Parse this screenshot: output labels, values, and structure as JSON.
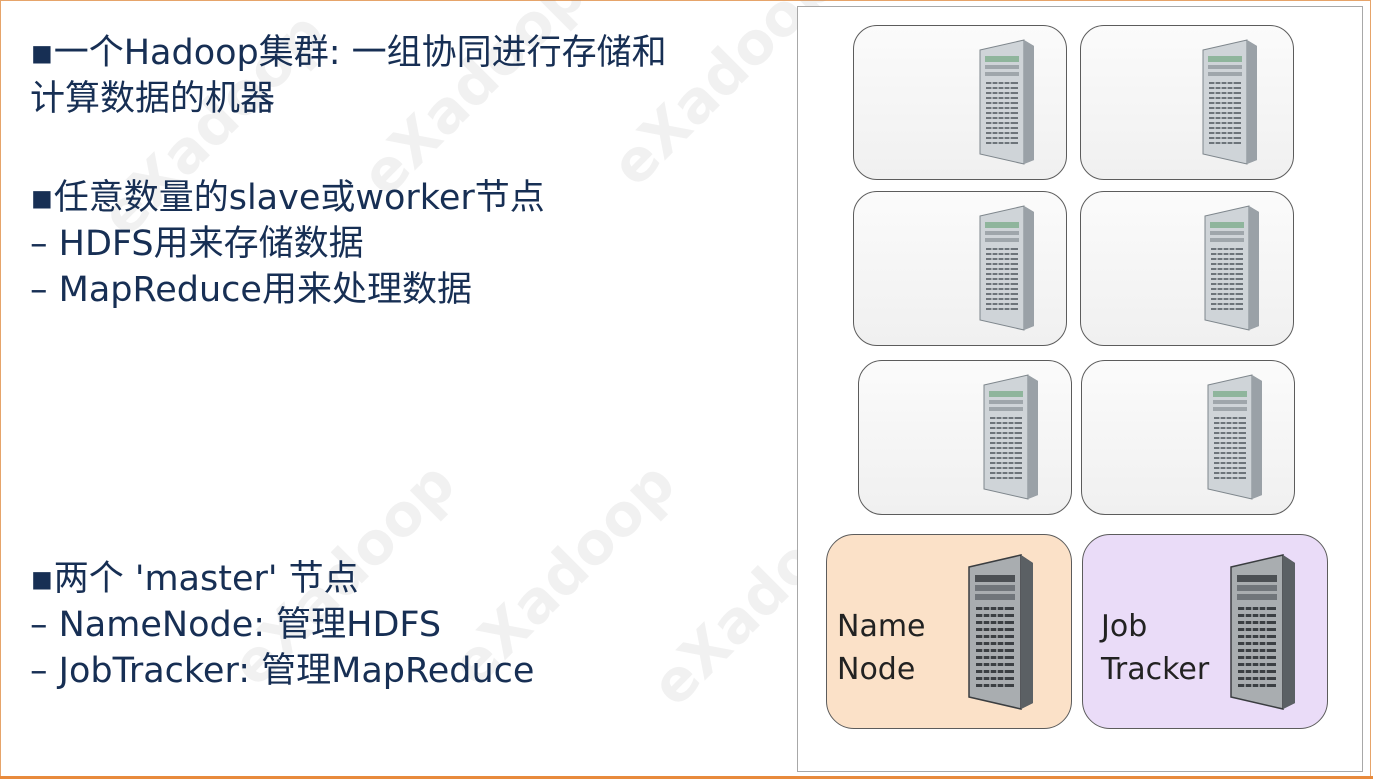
{
  "slide": {
    "section1": {
      "line1": "▪一个Hadoop集群: 一组协同进行存储和",
      "line2": "计算数据的机器"
    },
    "section2": {
      "line1": "▪任意数量的slave或worker节点",
      "line2": "– HDFS用来存储数据",
      "line3": "– MapReduce用来处理数据"
    },
    "section3": {
      "line1": "▪两个 'master' 节点",
      "line2": "– NameNode: 管理HDFS",
      "line3": "– JobTracker: 管理MapReduce"
    },
    "watermark": "eXadoop"
  },
  "diagram": {
    "worker_icon": "server-tower-icon",
    "name_node": {
      "line1": "Name",
      "line2": "Node"
    },
    "job_tracker": {
      "line1": "Job",
      "line2": "Tracker"
    }
  },
  "colors": {
    "text": "#172f54",
    "accent_line": "#e88a3c",
    "name_node_fill": "#fbe1c8",
    "job_tracker_fill": "#eadcf8"
  }
}
